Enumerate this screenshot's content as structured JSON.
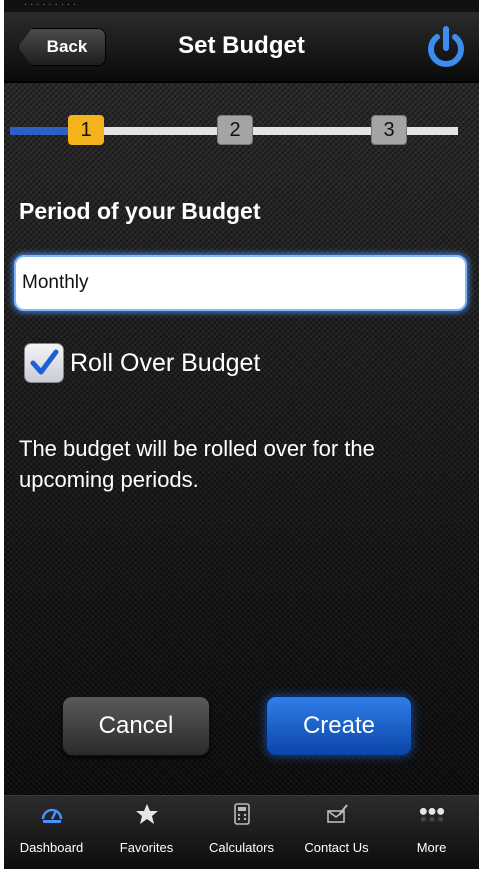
{
  "status_bar": {
    "text": "· · · · · · · · ·"
  },
  "nav": {
    "back_label": "Back",
    "title": "Set Budget",
    "power_icon": "power-icon"
  },
  "steps": [
    {
      "label": "1",
      "state": "active"
    },
    {
      "label": "2",
      "state": "pending"
    },
    {
      "label": "3",
      "state": "pending"
    }
  ],
  "form": {
    "section_label": "Period of your Budget",
    "period_value": "Monthly",
    "rollover_label": "Roll Over Budget",
    "rollover_checked": true,
    "info_text": "The budget will be rolled over for the upcoming periods."
  },
  "buttons": {
    "cancel": "Cancel",
    "create": "Create"
  },
  "tabs": [
    {
      "label": "Dashboard",
      "icon": "dashboard-icon"
    },
    {
      "label": "Favorites",
      "icon": "star-icon"
    },
    {
      "label": "Calculators",
      "icon": "calculator-icon"
    },
    {
      "label": "Contact Us",
      "icon": "contact-icon"
    },
    {
      "label": "More",
      "icon": "more-icon"
    }
  ],
  "colors": {
    "accent_blue": "#2e5fc9",
    "step_active": "#f4b21c",
    "create_button": "#1a5fd0"
  }
}
